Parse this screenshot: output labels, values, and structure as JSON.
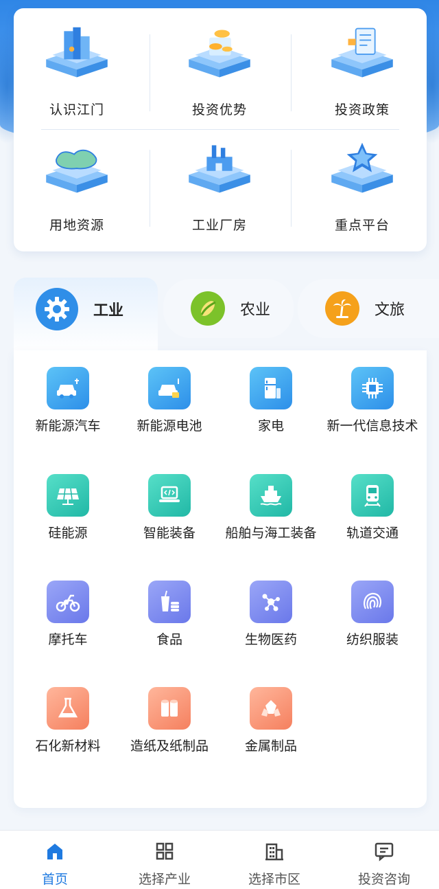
{
  "quick_access": [
    {
      "label": "认识江门",
      "icon": "city-buildings-icon"
    },
    {
      "label": "投资优势",
      "icon": "coins-icon"
    },
    {
      "label": "投资政策",
      "icon": "policy-document-icon"
    },
    {
      "label": "用地资源",
      "icon": "land-map-icon"
    },
    {
      "label": "工业厂房",
      "icon": "factory-icon"
    },
    {
      "label": "重点平台",
      "icon": "star-platform-icon"
    }
  ],
  "category_tabs": [
    {
      "label": "工业",
      "icon": "gear-icon",
      "active": true,
      "color": "#2f8ee8"
    },
    {
      "label": "农业",
      "icon": "corn-icon",
      "active": false,
      "color": "#7cc22a"
    },
    {
      "label": "文旅",
      "icon": "palm-tree-icon",
      "active": false,
      "color": "#f5a11b"
    }
  ],
  "industries": [
    {
      "label": "新能源汽车",
      "icon": "ev-car-icon",
      "color": "blue"
    },
    {
      "label": "新能源电池",
      "icon": "battery-car-icon",
      "color": "blue"
    },
    {
      "label": "家电",
      "icon": "refrigerator-icon",
      "color": "blue"
    },
    {
      "label": "新一代信息技术",
      "icon": "chip-icon",
      "color": "blue"
    },
    {
      "label": "硅能源",
      "icon": "solar-panel-icon",
      "color": "teal"
    },
    {
      "label": "智能装备",
      "icon": "laptop-code-icon",
      "color": "teal"
    },
    {
      "label": "船舶与海工装备",
      "icon": "ship-icon",
      "color": "teal"
    },
    {
      "label": "轨道交通",
      "icon": "train-icon",
      "color": "teal"
    },
    {
      "label": "摩托车",
      "icon": "motorcycle-icon",
      "color": "purple"
    },
    {
      "label": "食品",
      "icon": "food-drink-icon",
      "color": "purple"
    },
    {
      "label": "生物医药",
      "icon": "molecule-icon",
      "color": "purple"
    },
    {
      "label": "纺织服装",
      "icon": "fabric-icon",
      "color": "purple"
    },
    {
      "label": "石化新材料",
      "icon": "flask-icon",
      "color": "coral"
    },
    {
      "label": "造纸及纸制品",
      "icon": "paper-rolls-icon",
      "color": "coral"
    },
    {
      "label": "金属制品",
      "icon": "metal-ore-icon",
      "color": "coral"
    }
  ],
  "bottom_nav": [
    {
      "label": "首页",
      "icon": "home-icon",
      "active": true
    },
    {
      "label": "选择产业",
      "icon": "grid-icon",
      "active": false
    },
    {
      "label": "选择市区",
      "icon": "building-icon",
      "active": false
    },
    {
      "label": "投资咨询",
      "icon": "chat-icon",
      "active": false
    }
  ],
  "colors": {
    "accent": "#1f7ae0",
    "header_blue": "#2f86e6",
    "icon_blue": "#2d8fe9",
    "icon_teal": "#21b8a6",
    "icon_purple": "#6a78ea",
    "icon_coral": "#f5805f"
  }
}
